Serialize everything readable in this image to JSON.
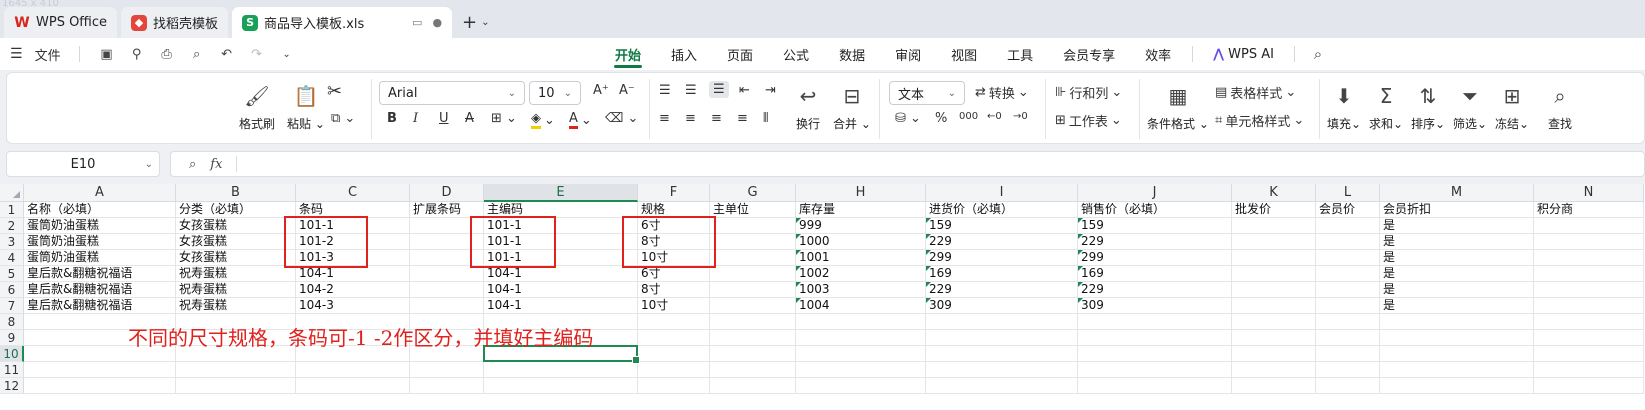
{
  "window": {
    "dims_label": "1645 x 410",
    "tabs": [
      {
        "label": "WPS Office",
        "icon": "wps-logo-icon"
      },
      {
        "label": "找稻壳模板",
        "icon": "docer-icon"
      },
      {
        "label": "商品导入模板.xls",
        "icon": "spreadsheet-s-icon",
        "badge": "S"
      }
    ]
  },
  "menubar": {
    "file_label": "文件",
    "menus": [
      "开始",
      "插入",
      "页面",
      "公式",
      "数据",
      "审阅",
      "视图",
      "工具",
      "会员专享",
      "效率"
    ],
    "active_menu": "开始",
    "ai_label": "WPS AI"
  },
  "ribbon": {
    "format_painter": "格式刷",
    "paste": "粘贴",
    "font_name": "Arial",
    "font_size": "10",
    "wrap": "换行",
    "merge": "合并",
    "number_format": "文本",
    "convert": "转换",
    "row_col": "行和列",
    "worksheet": "工作表",
    "cond_format": "条件格式",
    "table_style": "表格样式",
    "cell_style": "单元格样式",
    "fill": "填充",
    "sum": "求和",
    "sort": "排序",
    "filter": "筛选",
    "freeze": "冻结",
    "find": "查找"
  },
  "formula_bar": {
    "name_box": "E10",
    "fx": "fx",
    "content": ""
  },
  "sheet": {
    "columns": [
      "A",
      "B",
      "C",
      "D",
      "E",
      "F",
      "G",
      "H",
      "I",
      "J",
      "K",
      "L",
      "M",
      "N"
    ],
    "selected_column": "E",
    "rows": [
      "1",
      "2",
      "3",
      "4",
      "5",
      "6",
      "7",
      "8",
      "9",
      "10",
      "11",
      "12"
    ],
    "selected_row": "10",
    "headers": [
      "名称（必填）",
      "分类（必填）",
      "条码",
      "扩展条码",
      "主编码",
      "规格",
      "主单位",
      "库存量",
      "进货价（必填）",
      "销售价（必填）",
      "批发价",
      "会员价",
      "会员折扣",
      "积分商"
    ],
    "data": [
      [
        "蛋筒奶油蛋糕",
        "女孩蛋糕",
        "101-1",
        "",
        "101-1",
        "6寸",
        "",
        "999",
        "159",
        "159",
        "",
        "",
        "是",
        ""
      ],
      [
        "蛋筒奶油蛋糕",
        "女孩蛋糕",
        "101-2",
        "",
        "101-1",
        "8寸",
        "",
        "1000",
        "229",
        "229",
        "",
        "",
        "是",
        ""
      ],
      [
        "蛋筒奶油蛋糕",
        "女孩蛋糕",
        "101-3",
        "",
        "101-1",
        "10寸",
        "",
        "1001",
        "299",
        "299",
        "",
        "",
        "是",
        ""
      ],
      [
        "皇后款&翻糖祝福语",
        "祝寿蛋糕",
        "104-1",
        "",
        "104-1",
        "6寸",
        "",
        "1002",
        "169",
        "169",
        "",
        "",
        "是",
        ""
      ],
      [
        "皇后款&翻糖祝福语",
        "祝寿蛋糕",
        "104-2",
        "",
        "104-1",
        "8寸",
        "",
        "1003",
        "229",
        "229",
        "",
        "",
        "是",
        ""
      ],
      [
        "皇后款&翻糖祝福语",
        "祝寿蛋糕",
        "104-3",
        "",
        "104-1",
        "10寸",
        "",
        "1004",
        "309",
        "309",
        "",
        "",
        "是",
        ""
      ]
    ],
    "annotation": "不同的尺寸规格，条码可-1 -2作区分，并填好主编码"
  }
}
